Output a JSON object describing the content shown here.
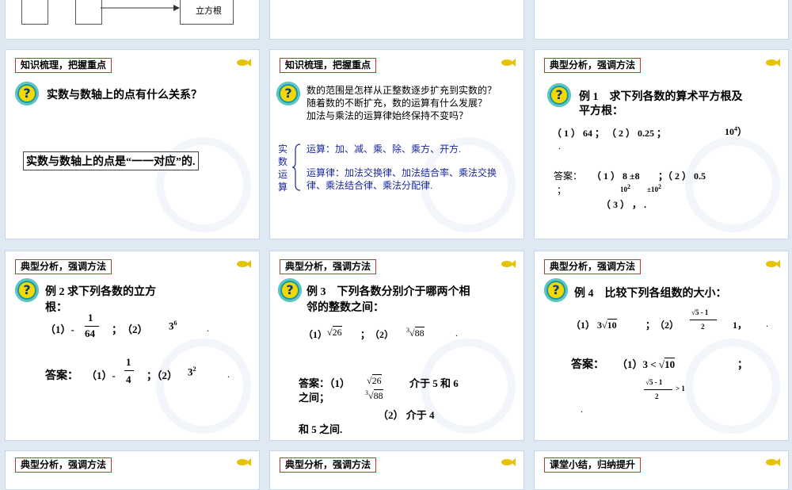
{
  "top_row": {
    "root_label": "立方根"
  },
  "s1": {
    "header": "知识梳理，把握重点",
    "question": "实数与数轴上的点有什么关系？",
    "answer": "实数与数轴上的点是“一一对应”的."
  },
  "s2": {
    "header": "知识梳理，把握重点",
    "q_lines": [
      "数的范围是怎样从正整数逐步扩充到实数的？",
      "随着数的不断扩充，数的运算有什么发展？",
      "加法与乘法的运算律始终保持不变吗？"
    ],
    "side_chars": [
      "实",
      "数",
      "运",
      "算"
    ],
    "op_line": "运算：加、减、乘、除、乘方、开方.",
    "law_line1": "运算律：加法交换律、加法结合率、乘法交换",
    "law_line2": "律、乘法结合律、乘法分配律."
  },
  "s3": {
    "header": "典型分析，强调方法",
    "title1": "例 1　求下列各数的算术平方根及",
    "title2": "平方根：",
    "items": "（ 1 ）  64 ；          （ 2 ）  0.25 ；",
    "item3": "10",
    "answer_label": "答案：",
    "a1": "（ 1 ）  8 ±8",
    "a2": "；（ 2 ）  0.5",
    "a3": "（ 3 ）        ，       ."
  },
  "s4": {
    "header": "典型分析，强调方法",
    "title1": "例 2  求下列各数的立方",
    "title2": "根：",
    "item1": "（1）-",
    "frac1_num": "1",
    "frac1_den": "64",
    "item2": "；　（2）",
    "item2_val": "3",
    "answer_label": "答案：",
    "ans1": "（1）-",
    "ans_frac_num": "1",
    "ans_frac_den": "4",
    "ans2": "；（2）",
    "ans2_val": "3"
  },
  "s5": {
    "header": "典型分析，强调方法",
    "title1": "例 3　下列各数分别介于哪两个相",
    "title2": "邻的整数之间：",
    "item1": "（1）",
    "item1_val": "26",
    "item2": "；　（2）",
    "item2_val": "88",
    "ans_line1": "答案：（1）",
    "ans_val1": "26",
    "ans_between1": "介于 5 和 6",
    "ans_line2": "之间；",
    "ans_val2": "88",
    "ans_line3": "（2）          介于 4",
    "ans_line4": "和 5 之间."
  },
  "s6": {
    "header": "典型分析，强调方法",
    "title": "例 4　比较下列各组数的大小：",
    "item1": "（1）  3",
    "item1_val": "10",
    "item2": "；　（2）",
    "item2_rest": "1，",
    "answer_label": "答案：",
    "ans1": "（1）3 <",
    "ans1_val": "10",
    "ans1_end": "；",
    "ans2_num": "√5 - 1",
    "ans2_den": "2",
    "ans2_rel": "> 1"
  },
  "bottom_row": {
    "h1": "典型分析，强调方法",
    "h2": "典型分析，强调方法",
    "h3": "课堂小结，归纳提升"
  }
}
